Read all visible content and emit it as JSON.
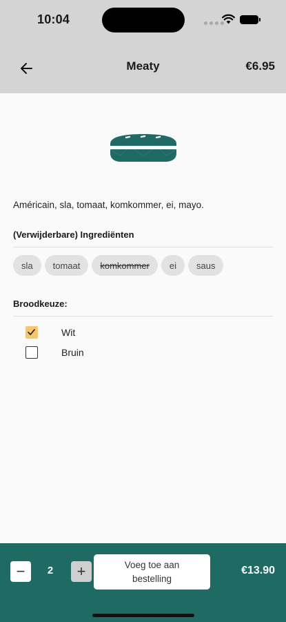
{
  "status_bar": {
    "time": "10:04"
  },
  "header": {
    "title": "Meaty",
    "price": "€6.95"
  },
  "product": {
    "icon": "sandwich-icon",
    "description": "Américain, sla, tomaat, komkommer, ei, mayo."
  },
  "ingredients": {
    "title": "(Verwijderbare) Ingrediënten",
    "chips": [
      {
        "label": "sla",
        "removed": false
      },
      {
        "label": "tomaat",
        "removed": false
      },
      {
        "label": "komkommer",
        "removed": true
      },
      {
        "label": "ei",
        "removed": false
      },
      {
        "label": "saus",
        "removed": false
      }
    ]
  },
  "bread": {
    "title": "Broodkeuze:",
    "options": [
      {
        "label": "Wit",
        "checked": true
      },
      {
        "label": "Bruin",
        "checked": false
      }
    ]
  },
  "order_bar": {
    "minus": "−",
    "quantity": "2",
    "plus": "+",
    "add_label": "Voeg toe aan bestelling",
    "total": "€13.90"
  },
  "colors": {
    "primary": "#1e6b63",
    "header_bg": "#d4d4d4",
    "checkbox_checked": "#f7c66b"
  }
}
